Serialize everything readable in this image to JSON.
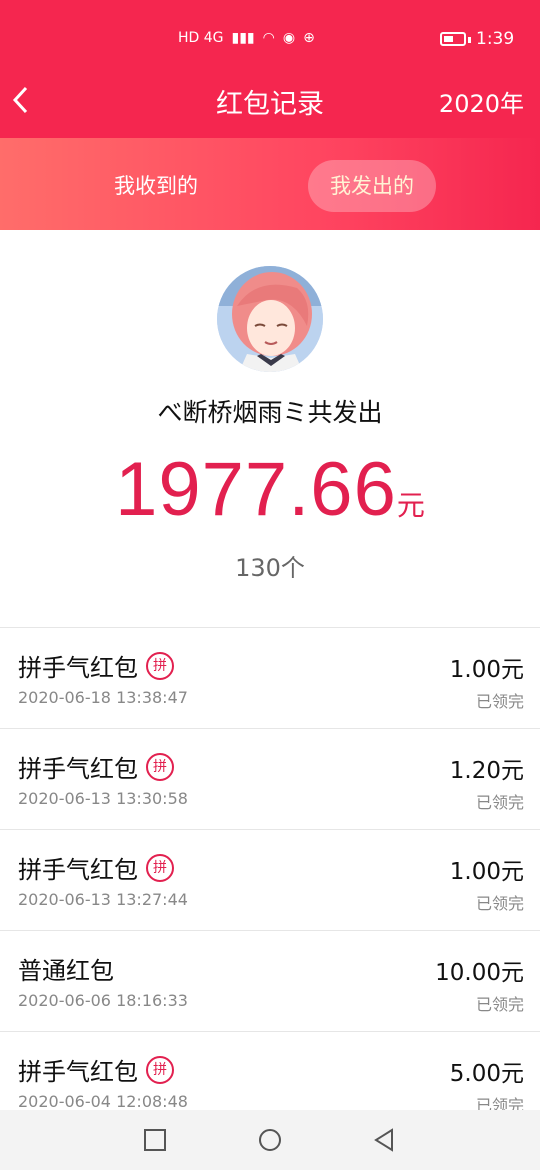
{
  "status_bar": {
    "network": "HD 4G",
    "time": "1:39"
  },
  "header": {
    "title": "红包记录",
    "year": "2020年"
  },
  "tabs": [
    {
      "label": "我收到的",
      "active": false
    },
    {
      "label": "我发出的",
      "active": true
    }
  ],
  "summary": {
    "title": "べ断桥烟雨ミ共发出",
    "amount": "1977.66",
    "unit": "元",
    "count": "130个"
  },
  "records": [
    {
      "title": "拼手气红包",
      "pin": "拼",
      "time": "2020-06-18 13:38:47",
      "amount": "1.00元",
      "status": "已领完"
    },
    {
      "title": "拼手气红包",
      "pin": "拼",
      "time": "2020-06-13 13:30:58",
      "amount": "1.20元",
      "status": "已领完"
    },
    {
      "title": "拼手气红包",
      "pin": "拼",
      "time": "2020-06-13 13:27:44",
      "amount": "1.00元",
      "status": "已领完"
    },
    {
      "title": "普通红包",
      "pin": "",
      "time": "2020-06-06 18:16:33",
      "amount": "10.00元",
      "status": "已领完"
    },
    {
      "title": "拼手气红包",
      "pin": "拼",
      "time": "2020-06-04 12:08:48",
      "amount": "5.00元",
      "status": "已领完"
    }
  ],
  "colors": {
    "header": "#f5264f",
    "accent": "#e2204f",
    "active_tab_text": "#fff4d5"
  },
  "icons": [
    "back-icon",
    "square-nav-icon",
    "home-nav-icon",
    "back-nav-icon"
  ]
}
